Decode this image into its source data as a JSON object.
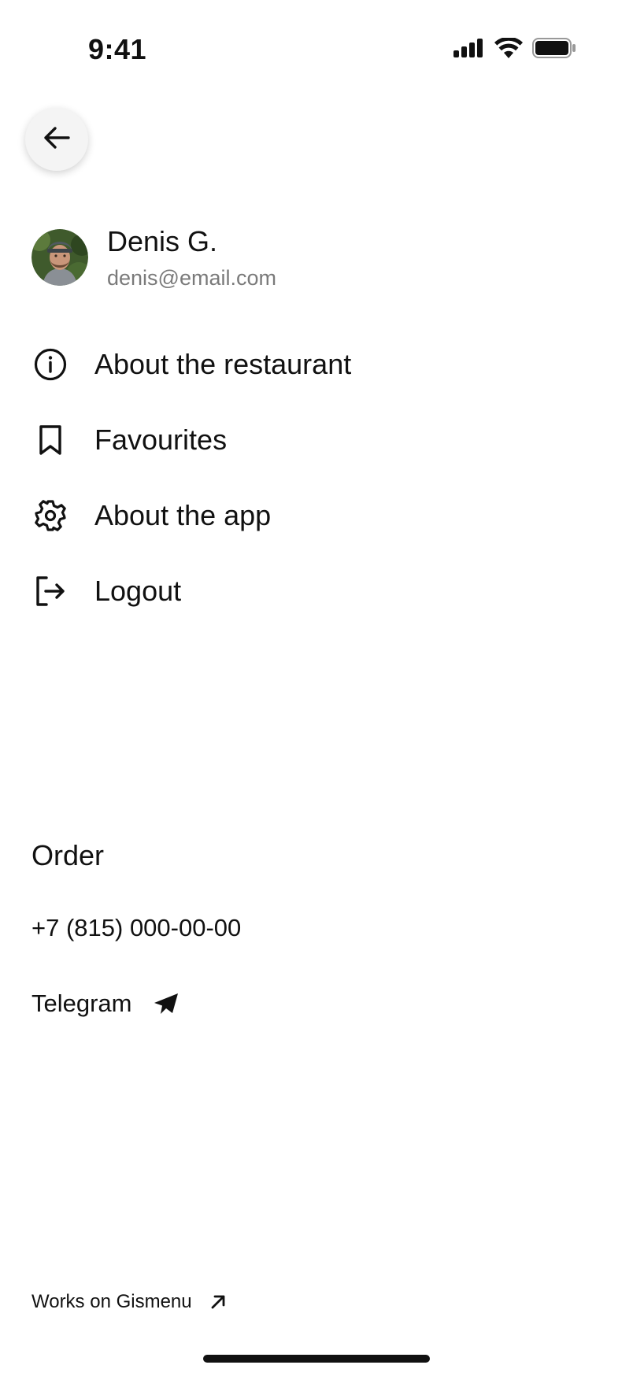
{
  "status_bar": {
    "time": "9:41",
    "icons": [
      "cellular-signal-icon",
      "wifi-icon",
      "battery-icon"
    ]
  },
  "header": {
    "back_icon": "arrow-left-icon"
  },
  "profile": {
    "name": "Denis G.",
    "email": "denis@email.com"
  },
  "menu": {
    "items": [
      {
        "label": "About the restaurant",
        "icon": "info-icon"
      },
      {
        "label": "Favourites",
        "icon": "bookmark-icon"
      },
      {
        "label": "About the app",
        "icon": "gear-icon"
      },
      {
        "label": "Logout",
        "icon": "logout-icon"
      }
    ]
  },
  "order": {
    "title": "Order",
    "phone": "+7 (815) 000-00-00",
    "telegram_label": "Telegram",
    "telegram_icon": "telegram-icon"
  },
  "footer": {
    "label": "Works on Gismenu",
    "icon": "arrow-up-right-icon"
  },
  "colors": {
    "text": "#111111",
    "secondary_text": "#7a7a7a",
    "back_button_bg": "#f4f4f4"
  }
}
